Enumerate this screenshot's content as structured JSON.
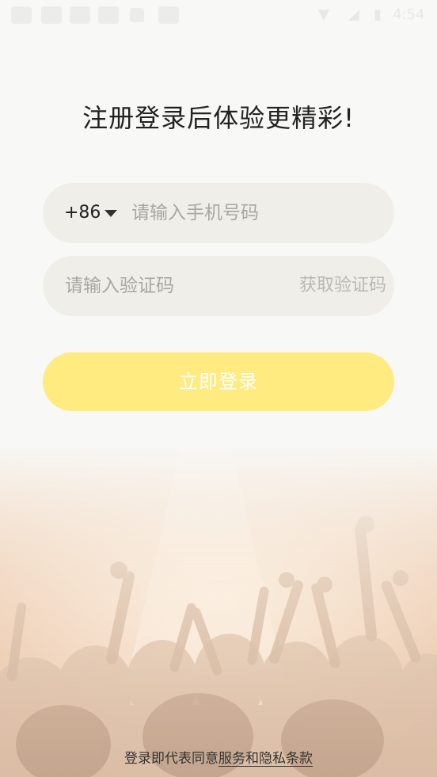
{
  "status_bar": {
    "right_text": "4:54"
  },
  "headline": "注册登录后体验更精彩!",
  "phone": {
    "country_code": "+86",
    "placeholder": "请输入手机号码"
  },
  "code": {
    "placeholder": "请输入验证码",
    "get_code_label": "获取验证码"
  },
  "login_button": "立即登录",
  "terms": {
    "prefix": "登录即代表同意",
    "link": "服务和隐私条款"
  },
  "colors": {
    "accent": "#ffeb7f",
    "field_bg": "#efeee9",
    "placeholder": "#a8a7a3"
  }
}
